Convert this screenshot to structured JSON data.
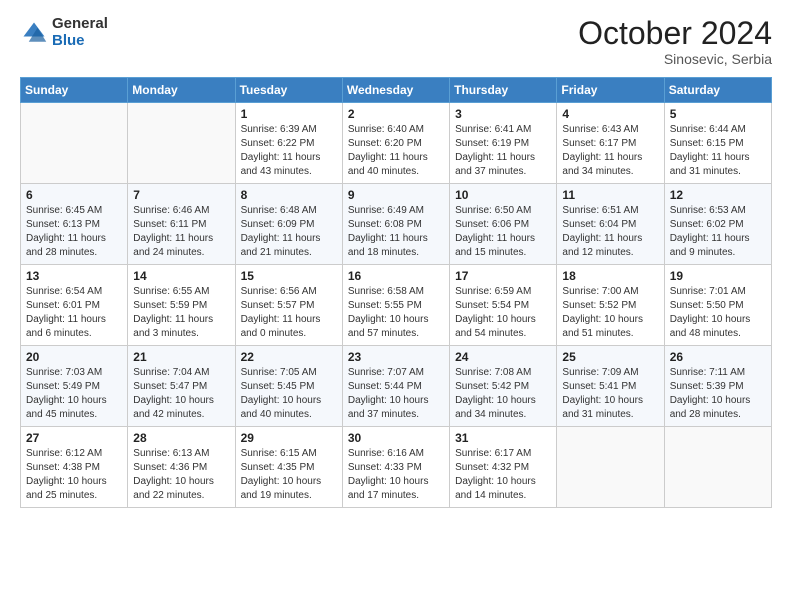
{
  "logo": {
    "general": "General",
    "blue": "Blue"
  },
  "title": "October 2024",
  "location": "Sinosevic, Serbia",
  "days_of_week": [
    "Sunday",
    "Monday",
    "Tuesday",
    "Wednesday",
    "Thursday",
    "Friday",
    "Saturday"
  ],
  "weeks": [
    [
      {
        "day": "",
        "info": ""
      },
      {
        "day": "",
        "info": ""
      },
      {
        "day": "1",
        "info": "Sunrise: 6:39 AM\nSunset: 6:22 PM\nDaylight: 11 hours and 43 minutes."
      },
      {
        "day": "2",
        "info": "Sunrise: 6:40 AM\nSunset: 6:20 PM\nDaylight: 11 hours and 40 minutes."
      },
      {
        "day": "3",
        "info": "Sunrise: 6:41 AM\nSunset: 6:19 PM\nDaylight: 11 hours and 37 minutes."
      },
      {
        "day": "4",
        "info": "Sunrise: 6:43 AM\nSunset: 6:17 PM\nDaylight: 11 hours and 34 minutes."
      },
      {
        "day": "5",
        "info": "Sunrise: 6:44 AM\nSunset: 6:15 PM\nDaylight: 11 hours and 31 minutes."
      }
    ],
    [
      {
        "day": "6",
        "info": "Sunrise: 6:45 AM\nSunset: 6:13 PM\nDaylight: 11 hours and 28 minutes."
      },
      {
        "day": "7",
        "info": "Sunrise: 6:46 AM\nSunset: 6:11 PM\nDaylight: 11 hours and 24 minutes."
      },
      {
        "day": "8",
        "info": "Sunrise: 6:48 AM\nSunset: 6:09 PM\nDaylight: 11 hours and 21 minutes."
      },
      {
        "day": "9",
        "info": "Sunrise: 6:49 AM\nSunset: 6:08 PM\nDaylight: 11 hours and 18 minutes."
      },
      {
        "day": "10",
        "info": "Sunrise: 6:50 AM\nSunset: 6:06 PM\nDaylight: 11 hours and 15 minutes."
      },
      {
        "day": "11",
        "info": "Sunrise: 6:51 AM\nSunset: 6:04 PM\nDaylight: 11 hours and 12 minutes."
      },
      {
        "day": "12",
        "info": "Sunrise: 6:53 AM\nSunset: 6:02 PM\nDaylight: 11 hours and 9 minutes."
      }
    ],
    [
      {
        "day": "13",
        "info": "Sunrise: 6:54 AM\nSunset: 6:01 PM\nDaylight: 11 hours and 6 minutes."
      },
      {
        "day": "14",
        "info": "Sunrise: 6:55 AM\nSunset: 5:59 PM\nDaylight: 11 hours and 3 minutes."
      },
      {
        "day": "15",
        "info": "Sunrise: 6:56 AM\nSunset: 5:57 PM\nDaylight: 11 hours and 0 minutes."
      },
      {
        "day": "16",
        "info": "Sunrise: 6:58 AM\nSunset: 5:55 PM\nDaylight: 10 hours and 57 minutes."
      },
      {
        "day": "17",
        "info": "Sunrise: 6:59 AM\nSunset: 5:54 PM\nDaylight: 10 hours and 54 minutes."
      },
      {
        "day": "18",
        "info": "Sunrise: 7:00 AM\nSunset: 5:52 PM\nDaylight: 10 hours and 51 minutes."
      },
      {
        "day": "19",
        "info": "Sunrise: 7:01 AM\nSunset: 5:50 PM\nDaylight: 10 hours and 48 minutes."
      }
    ],
    [
      {
        "day": "20",
        "info": "Sunrise: 7:03 AM\nSunset: 5:49 PM\nDaylight: 10 hours and 45 minutes."
      },
      {
        "day": "21",
        "info": "Sunrise: 7:04 AM\nSunset: 5:47 PM\nDaylight: 10 hours and 42 minutes."
      },
      {
        "day": "22",
        "info": "Sunrise: 7:05 AM\nSunset: 5:45 PM\nDaylight: 10 hours and 40 minutes."
      },
      {
        "day": "23",
        "info": "Sunrise: 7:07 AM\nSunset: 5:44 PM\nDaylight: 10 hours and 37 minutes."
      },
      {
        "day": "24",
        "info": "Sunrise: 7:08 AM\nSunset: 5:42 PM\nDaylight: 10 hours and 34 minutes."
      },
      {
        "day": "25",
        "info": "Sunrise: 7:09 AM\nSunset: 5:41 PM\nDaylight: 10 hours and 31 minutes."
      },
      {
        "day": "26",
        "info": "Sunrise: 7:11 AM\nSunset: 5:39 PM\nDaylight: 10 hours and 28 minutes."
      }
    ],
    [
      {
        "day": "27",
        "info": "Sunrise: 6:12 AM\nSunset: 4:38 PM\nDaylight: 10 hours and 25 minutes."
      },
      {
        "day": "28",
        "info": "Sunrise: 6:13 AM\nSunset: 4:36 PM\nDaylight: 10 hours and 22 minutes."
      },
      {
        "day": "29",
        "info": "Sunrise: 6:15 AM\nSunset: 4:35 PM\nDaylight: 10 hours and 19 minutes."
      },
      {
        "day": "30",
        "info": "Sunrise: 6:16 AM\nSunset: 4:33 PM\nDaylight: 10 hours and 17 minutes."
      },
      {
        "day": "31",
        "info": "Sunrise: 6:17 AM\nSunset: 4:32 PM\nDaylight: 10 hours and 14 minutes."
      },
      {
        "day": "",
        "info": ""
      },
      {
        "day": "",
        "info": ""
      }
    ]
  ]
}
